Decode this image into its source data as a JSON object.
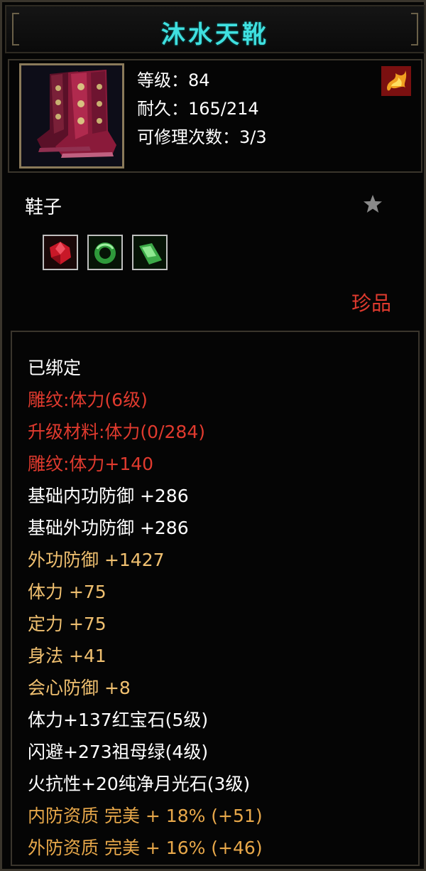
{
  "item": {
    "name": "沐水天靴",
    "stats": {
      "level": "等级：84",
      "durability": "耐久：165/214",
      "repairs": "可修理次数：3/3"
    },
    "type": "鞋子",
    "quality": "珍品",
    "gems": [
      {
        "name": "ruby-gem",
        "color": "#d0202a"
      },
      {
        "name": "emerald-ring-gem",
        "color": "#3fb04a"
      },
      {
        "name": "moonstone-gem",
        "color": "#5ad06a"
      }
    ]
  },
  "attributes": [
    {
      "text": "已绑定",
      "color": "#ffffff"
    },
    {
      "text": "雕纹:体力(6级)",
      "color": "#e03a2e"
    },
    {
      "text": "升级材料:体力(0/284)",
      "color": "#e03a2e"
    },
    {
      "text": "雕纹:体力+140",
      "color": "#e03a2e"
    },
    {
      "text": "基础内功防御 +286",
      "color": "#ffffff"
    },
    {
      "text": "基础外功防御 +286",
      "color": "#ffffff"
    },
    {
      "text": "外功防御 +1427",
      "color": "#f0c070"
    },
    {
      "text": "体力 +75",
      "color": "#f0c070"
    },
    {
      "text": "定力 +75",
      "color": "#f0c070"
    },
    {
      "text": "身法 +41",
      "color": "#f0c070"
    },
    {
      "text": "会心防御 +8",
      "color": "#f0c070"
    },
    {
      "text": "体力+137红宝石(5级)",
      "color": "#ffffff"
    },
    {
      "text": "闪避+273祖母绿(4级)",
      "color": "#ffffff"
    },
    {
      "text": "火抗性+20纯净月光石(3级)",
      "color": "#ffffff"
    },
    {
      "text": "内防资质 完美 + 18% (+51)",
      "color": "#e8a84a"
    },
    {
      "text": "外防资质 完美 + 16% (+46)",
      "color": "#e8a84a"
    }
  ]
}
